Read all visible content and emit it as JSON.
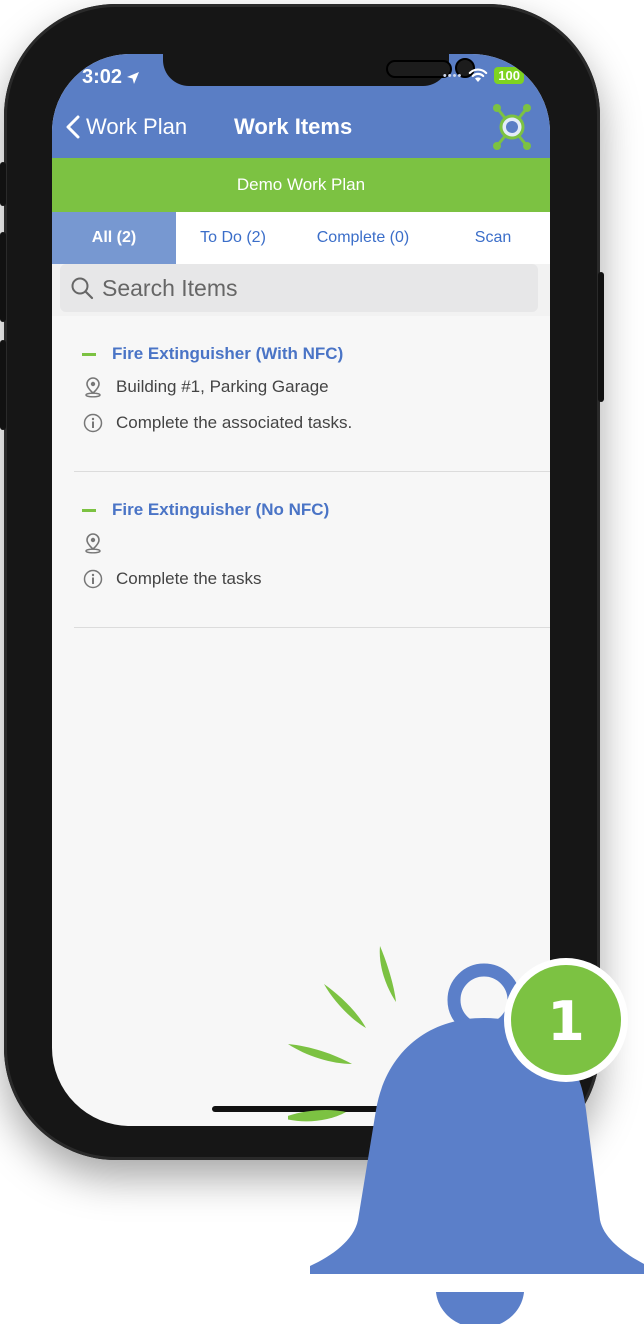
{
  "status_bar": {
    "time": "3:02",
    "battery": "100"
  },
  "nav": {
    "back_label": "Work Plan",
    "title": "Work Items"
  },
  "work_plan": {
    "name": "Demo Work Plan"
  },
  "tabs": [
    {
      "label": "All (2)",
      "active": true
    },
    {
      "label": "To Do (2)",
      "active": false
    },
    {
      "label": "Complete (0)",
      "active": false
    },
    {
      "label": "Scan",
      "active": false
    }
  ],
  "search": {
    "placeholder": "Search Items"
  },
  "items": [
    {
      "title": "Fire Extinguisher (With NFC)",
      "location": "Building #1, Parking Garage",
      "description": "Complete the associated tasks."
    },
    {
      "title": "Fire Extinguisher (No NFC)",
      "location": "",
      "description": "Complete the tasks"
    }
  ],
  "notification": {
    "count": "1"
  },
  "colors": {
    "header_blue": "#5a7ec5",
    "accent_green": "#7cc242",
    "link_blue": "#3b6ec9",
    "bell_blue": "#5b7fc9"
  }
}
